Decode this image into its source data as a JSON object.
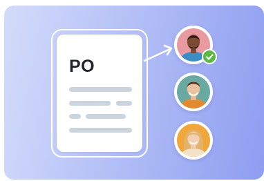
{
  "document": {
    "title": "PO",
    "icon": "document-icon"
  },
  "approvers": [
    {
      "name_icon": "man-avatar-icon",
      "status": "approved",
      "badge_icon": "check-circle-icon"
    },
    {
      "name_icon": "man-avatar-icon",
      "status": "pending"
    },
    {
      "name_icon": "woman-avatar-icon",
      "status": "pending"
    }
  ],
  "colors": {
    "accent_check": "#5cb946",
    "background_start": "#d4dcfb",
    "background_end": "#8e9df1"
  }
}
